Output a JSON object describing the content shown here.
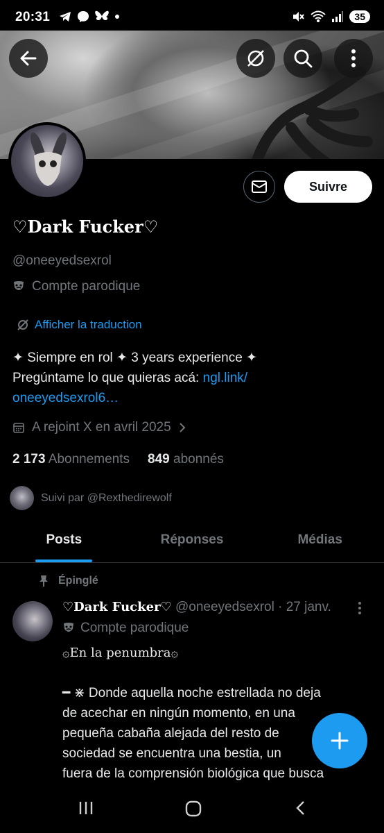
{
  "status_bar": {
    "time": "20:31",
    "battery": "35",
    "left_icons": [
      "telegram-icon",
      "messenger-icon",
      "bluesky-icon",
      "dot-icon"
    ],
    "right_icons": [
      "mute-icon",
      "wifi-icon",
      "signal-icon",
      "battery-icon"
    ]
  },
  "header": {
    "back_icon": "arrow-left-icon",
    "translate_icon": "translate-off-icon",
    "search_icon": "search-icon",
    "more_icon": "more-vertical-icon"
  },
  "profile": {
    "display_name": "♡Dark Fucker♡",
    "handle": "@oneeyedsexrol",
    "parody_label": "Compte parodique",
    "translate_label": "Afficher la traduction",
    "bio_line1": "✦ Siempre en rol ✦ 3 years experience ✦",
    "bio_line2_prefix": "Pregúntame lo que quieras acá: ",
    "bio_link_part1": "ngl.link/",
    "bio_link_part2": "oneeyedsexrol6…",
    "joined": "A rejoint X en avril 2025",
    "following_count": "2 173",
    "following_label": "Abonnements",
    "followers_count": "849",
    "followers_label": "abonnés",
    "followed_by": "Suivi par @Rexthedirewolf",
    "follow_button": "Suivre"
  },
  "tabs": [
    {
      "label": "Posts",
      "active": true
    },
    {
      "label": "Réponses",
      "active": false
    },
    {
      "label": "Médias",
      "active": false
    }
  ],
  "pinned_post": {
    "pinned_label": "Épinglé",
    "author_name": "♡Dark Fucker♡",
    "author_handle": "@oneeyedsexrol",
    "date": "· 27 janv.",
    "parody_label": "Compte parodique",
    "title": "۞En la penumbra۞",
    "body_line1": "━ ⋇ Donde aquella noche estrellada no deja",
    "body_line2": "de acechar en ningún momento, en una",
    "body_line3": "pequeña cabaña alejada del resto de",
    "body_line4": "sociedad se encuentra una bestia, un",
    "body_line5": "fuera de la comprensión biológica que busca"
  },
  "fab": {
    "label": "+"
  },
  "colors": {
    "accent": "#1d9bf0",
    "background": "#000000",
    "muted_text": "#71767b",
    "primary_text": "#e7e9ea"
  }
}
